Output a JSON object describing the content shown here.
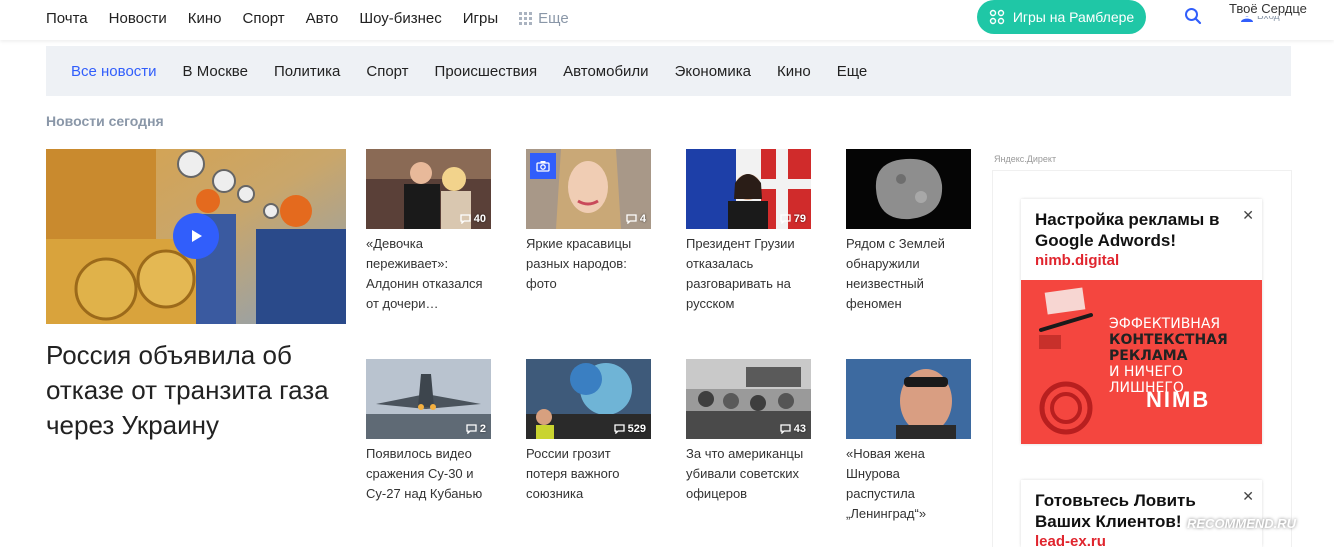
{
  "top_nav": {
    "items": [
      "Почта",
      "Новости",
      "Кино",
      "Спорт",
      "Авто",
      "Шоу-бизнес",
      "Игры"
    ],
    "more_label": "Еще",
    "games_button": "Игры на Рамблере",
    "login_label": "Вход",
    "overlay_ad_text": "Твоё Сердце"
  },
  "category_nav": {
    "items": [
      "Все новости",
      "В Москве",
      "Политика",
      "Спорт",
      "Происшествия",
      "Автомобили",
      "Экономика",
      "Кино",
      "Еще"
    ],
    "active_index": 0
  },
  "section_title": "Новости сегодня",
  "main_story": {
    "title": "Россия объявила об отказе от транзита газа через Украину",
    "has_video": true
  },
  "news_cards": [
    {
      "text": "«Девочка переживает»: Алдонин отказался от дочери…",
      "comments": "40"
    },
    {
      "text": "Яркие красавицы разных народов: фото",
      "comments": "4",
      "photo_gallery": true
    },
    {
      "text": "Президент Грузии отказалась разговаривать на русском",
      "comments": "79"
    },
    {
      "text": "Рядом с Землей обнаружили неизвестный феномен",
      "comments": ""
    },
    {
      "text": "Появилось видео сражения Су-30 и Су-27 над Кубанью",
      "comments": "2"
    },
    {
      "text": "России грозит потеря важного союзника",
      "comments": "529"
    },
    {
      "text": "За что американцы убивали советских офицеров",
      "comments": "43"
    },
    {
      "text": "«Новая жена Шнурова распустила „Ленинград“»",
      "comments": ""
    }
  ],
  "ads": {
    "label": "Яндекс.Директ",
    "items": [
      {
        "title": "Настройка рекламы в Google Adwords!",
        "domain": "nimb.digital",
        "banner_line1": "ЭФФЕКТИВНАЯ",
        "banner_line2": "КОНТЕКСТНАЯ",
        "banner_line3": "РЕКЛАМА",
        "banner_line4": "И НИЧЕГО ЛИШНЕГО",
        "banner_logo": "NIMB"
      },
      {
        "title": "Готовьтесь Ловить Ваших Клиентов!",
        "domain": "lead-ex.ru"
      }
    ]
  },
  "watermark": "RECOMMEND.RU",
  "colors": {
    "accent_blue": "#315efb",
    "games_green": "#1fc7a6",
    "ad_red": "#e0252e",
    "category_bg": "#eef1f5"
  }
}
